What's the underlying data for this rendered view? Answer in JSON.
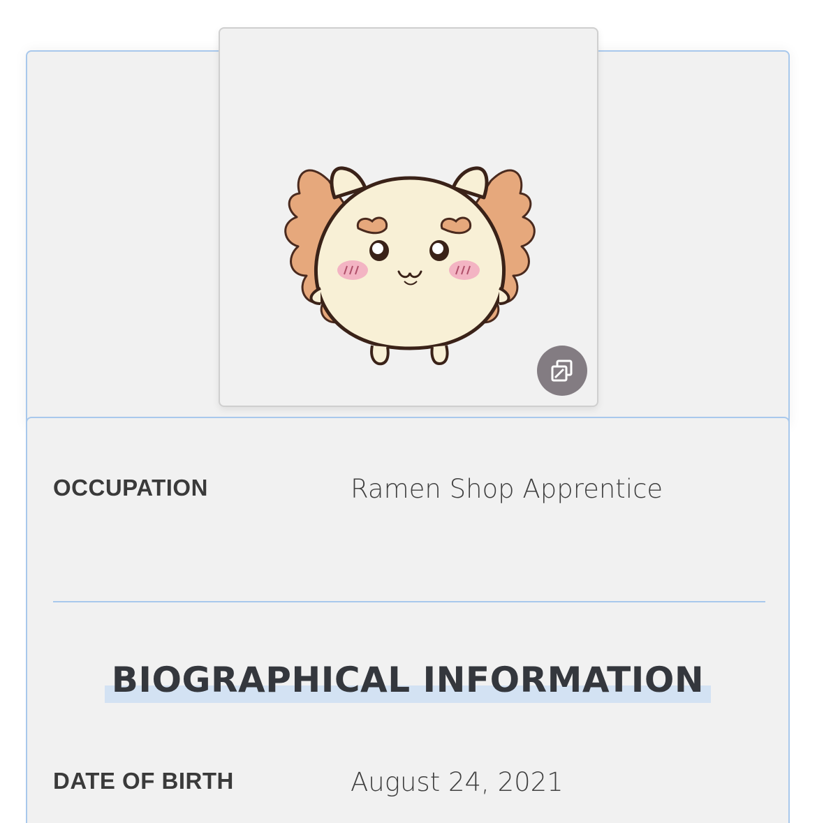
{
  "infobox": {
    "image": {
      "subject": "cream-colored round creature with orange lion-like mane",
      "gallery_icon": "gallery-icon"
    },
    "rows": [
      {
        "label": "OCCUPATION",
        "value": "Ramen Shop Apprentice"
      }
    ],
    "section_heading": "BIOGRAPHICAL INFORMATION",
    "bio_rows": [
      {
        "label": "DATE OF BIRTH",
        "value": "August 24, 2021"
      }
    ]
  },
  "colors": {
    "border_accent": "#a8c8ec",
    "heading_highlight": "#d3e2f3",
    "panel_background": "#f1f1f1",
    "gallery_button": "#837c82"
  }
}
